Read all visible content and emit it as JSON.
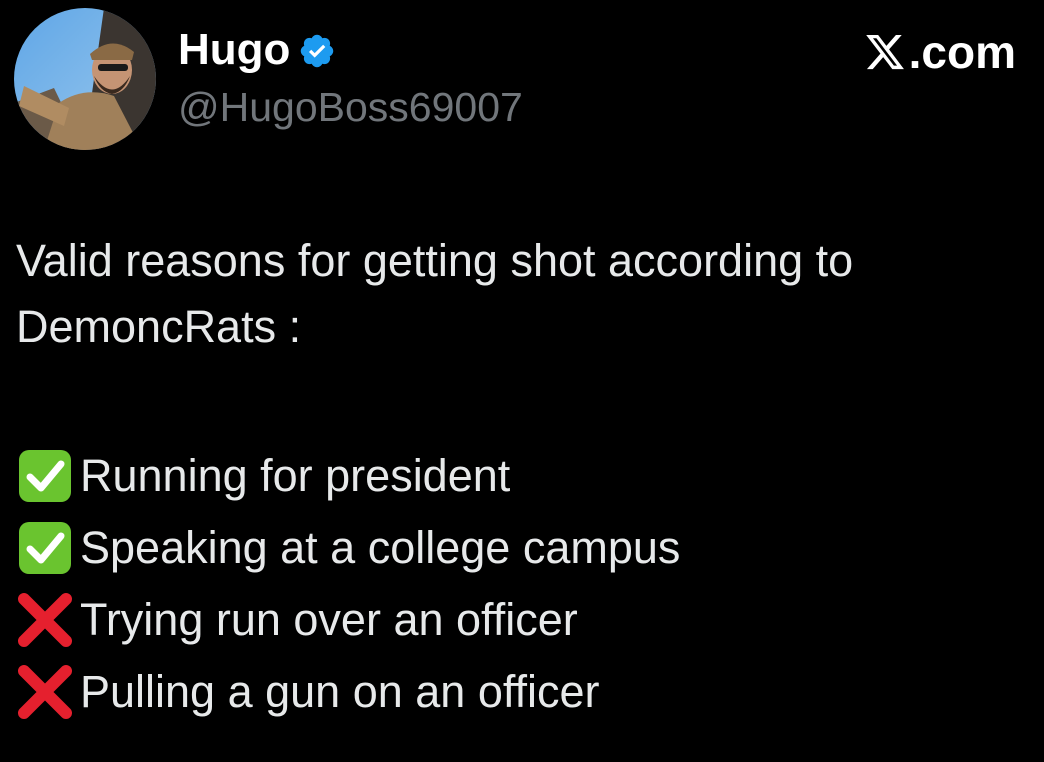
{
  "author": {
    "display_name": "Hugo",
    "handle": "@HugoBoss69007",
    "verified": true,
    "verified_color": "#1d9bf0"
  },
  "brand": {
    "suffix": ".com",
    "logo_icon": "x-logo-icon"
  },
  "post": {
    "intro_line1": "Valid reasons for getting shot according to",
    "intro_line2": "DemoncRats :",
    "items": [
      {
        "icon": "check-mark-button-icon",
        "text": "Running for president"
      },
      {
        "icon": "check-mark-button-icon",
        "text": "Speaking at a college campus"
      },
      {
        "icon": "cross-mark-icon",
        "text": "Trying run over an officer"
      },
      {
        "icon": "cross-mark-icon",
        "text": "Pulling a gun on an officer"
      }
    ]
  },
  "colors": {
    "background": "#000000",
    "text": "#e7e9ea",
    "handle": "#71767b",
    "check_green": "#6ac42f",
    "cross_red": "#e5202e"
  }
}
